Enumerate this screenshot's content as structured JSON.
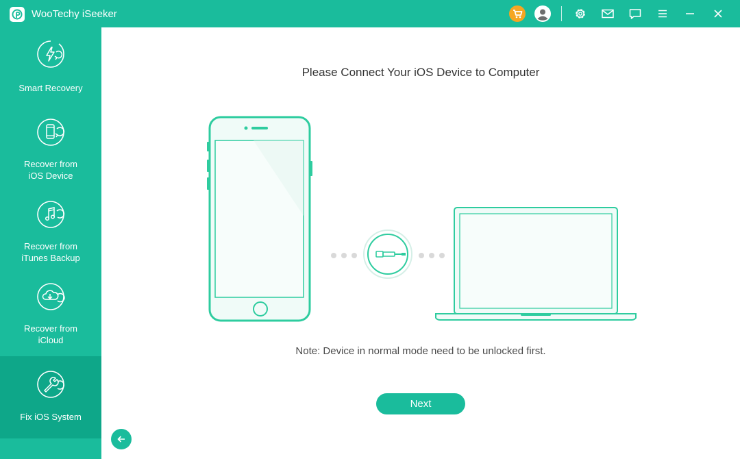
{
  "app": {
    "title": "WooTechy iSeeker"
  },
  "colors": {
    "accent": "#1abc9c",
    "accent_dark": "#0ea789",
    "cart": "#f5a623",
    "outline": "#2ecc9f",
    "device_fill": "#f0fbf8"
  },
  "titlebar": {
    "icons": [
      "shopping-cart-icon",
      "user-icon",
      "gear-icon",
      "mail-icon",
      "chat-icon",
      "menu-icon",
      "minimize-icon",
      "close-icon"
    ]
  },
  "sidebar": {
    "items": [
      {
        "label": "Smart Recovery",
        "icon": "smart-recovery-icon",
        "active": false
      },
      {
        "label": "Recover from\niOS Device",
        "icon": "ios-device-icon",
        "active": false
      },
      {
        "label": "Recover from\niTunes Backup",
        "icon": "itunes-backup-icon",
        "active": false
      },
      {
        "label": "Recover from\niCloud",
        "icon": "icloud-icon",
        "active": false
      },
      {
        "label": "Fix iOS System",
        "icon": "wrench-icon",
        "active": true
      }
    ]
  },
  "main": {
    "title": "Please Connect Your iOS Device to Computer",
    "note": "Note: Device in normal mode need to be unlocked first.",
    "next_label": "Next",
    "illustration_icons": [
      "iphone-icon",
      "usb-cable-icon",
      "laptop-icon"
    ]
  }
}
